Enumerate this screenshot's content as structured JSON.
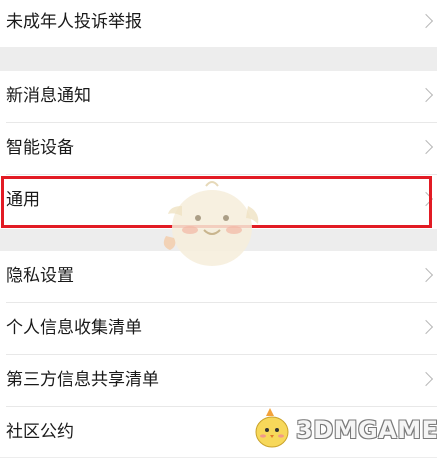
{
  "settings": {
    "items": [
      {
        "label": "未成年人投诉举报"
      },
      {
        "label": "新消息通知"
      },
      {
        "label": "智能设备"
      },
      {
        "label": "通用"
      },
      {
        "label": "隐私设置"
      },
      {
        "label": "个人信息收集清单"
      },
      {
        "label": "第三方信息共享清单"
      },
      {
        "label": "社区公约"
      }
    ],
    "highlighted_item": "通用",
    "highlight_color": "#e21b24"
  },
  "watermark": {
    "text": "3DMGAME"
  }
}
